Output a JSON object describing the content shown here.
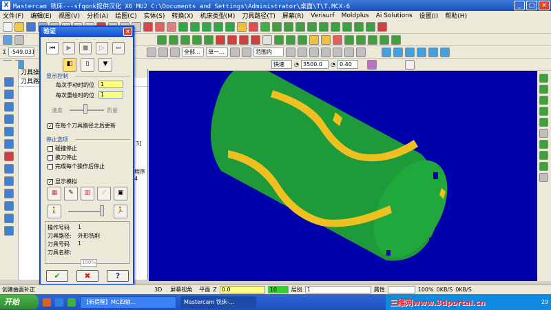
{
  "window": {
    "title": "Mastercam 铣床---sfqonk提供汉化 X6 MU2  C:\\Documents and Settings\\Administrator\\桌面\\T\\T.MCX-6",
    "min": "_",
    "max": "□",
    "close": "×"
  },
  "menu": [
    "文件(F)",
    "编辑(E)",
    "视图(V)",
    "分析(A)",
    "绘图(C)",
    "实体(S)",
    "转换(X)",
    "机床类型(M)",
    "刀具路径(T)",
    "屏幕(R)",
    "Verisurf",
    "Moldplus",
    "Ai Solutions",
    "设置(I)",
    "帮助(H)"
  ],
  "toolbar3": {
    "coord": "-549.031",
    "level_all": "全部...",
    "single": "单一...",
    "range": "范围内"
  },
  "toolbar4": {
    "fast": "快速",
    "speed": "3500.0",
    "feed": "0.40"
  },
  "ops_panel": {
    "title": "刀具操作",
    "tab": "刀具路径",
    "side_text_1": "3]",
    "side_text_2": "程序4"
  },
  "dialog": {
    "title": "验证",
    "close": "×",
    "group_display": "显示控制",
    "step_label": "每次手动时的位",
    "step_value": "1",
    "repeat_label": "每次重绘时的位",
    "repeat_value": "1",
    "speed_label": "速度",
    "quality_label": "质量",
    "update_label": "在每个刀具路径之后更新",
    "group_stop": "停止选项",
    "stop_collision": "碰撞停止",
    "stop_tool_change": "换刀停止",
    "stop_each_op": "完成每个操作后停止",
    "show_sim": "显示模拟",
    "info": {
      "op_no_label": "操作号码",
      "op_no": "1",
      "path_label": "刀具路径:",
      "path": "外形铣削",
      "tool_no_label": "刀具号码",
      "tool_no": "1",
      "tool_name_label": "刀具名称:"
    },
    "progress": "100%",
    "ok": "✔",
    "cancel": "✖",
    "help": "?"
  },
  "status": {
    "left": "创建曲面补正",
    "mode": "3D",
    "view": "屏幕视角",
    "plane": "平面",
    "z_label": "Z",
    "z_value": "0.0",
    "level_value": "10",
    "layer_label": "层别",
    "layer_value": "1",
    "attr": "属性",
    "zoom": "100%",
    "net1": "0KB/S",
    "net2": "0KB/S"
  },
  "taskbar": {
    "start": "开始",
    "task1": "【新提醒】MC四轴...",
    "task2": "Mastercam 铣床-...",
    "watermark": "三维网www.3dportal.cn",
    "clock": "29"
  },
  "colors": {
    "viewport_bg": "#0000aa",
    "part_green": "#1f9a3a",
    "groove_yellow": "#f0c020"
  }
}
